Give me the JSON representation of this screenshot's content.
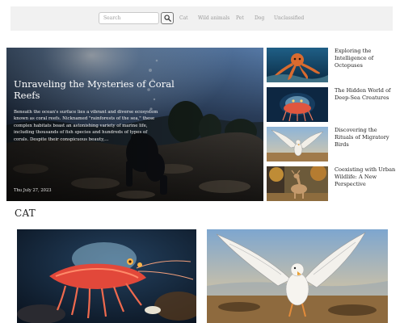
{
  "nav": {
    "search_placeholder": "Search",
    "links": [
      "Cat",
      "Wild animals",
      "Pet",
      "Dog",
      "Unclassified"
    ]
  },
  "hero": {
    "title": "Unraveling the Mysteries of Coral Reefs",
    "excerpt": "Beneath the ocean's surface lies a vibrant and diverse ecosystem known as coral reefs. Nicknamed \"rainforests of the sea,\" these complex habitats boast an astonishing variety of marine life, including thousands of fish species and hundreds of types of corals. Despite their conspicuous beauty,...",
    "date": "Thu July 27, 2023"
  },
  "side_articles": [
    {
      "title": "Exploring the Intelligence of Octopuses",
      "image": "octopus-image"
    },
    {
      "title": "The Hidden World of Deep-Sea Creatures",
      "image": "deep-sea-creature-image"
    },
    {
      "title": "Discovering the Rituals of Migratory Birds",
      "image": "migratory-bird-image"
    },
    {
      "title": "Coexisting with Urban Wildlife: A New Perspective",
      "image": "deer-image"
    }
  ],
  "section": {
    "heading": "CAT",
    "cards": [
      {
        "image": "glowing-shrimp-image"
      },
      {
        "image": "seagull-image"
      }
    ]
  },
  "colors": {
    "nav_background": "#f1f1f1",
    "nav_link": "#9a9a9a",
    "text": "#222222",
    "hero_text": "#ffffff"
  },
  "icons": {
    "search": "search-icon"
  }
}
